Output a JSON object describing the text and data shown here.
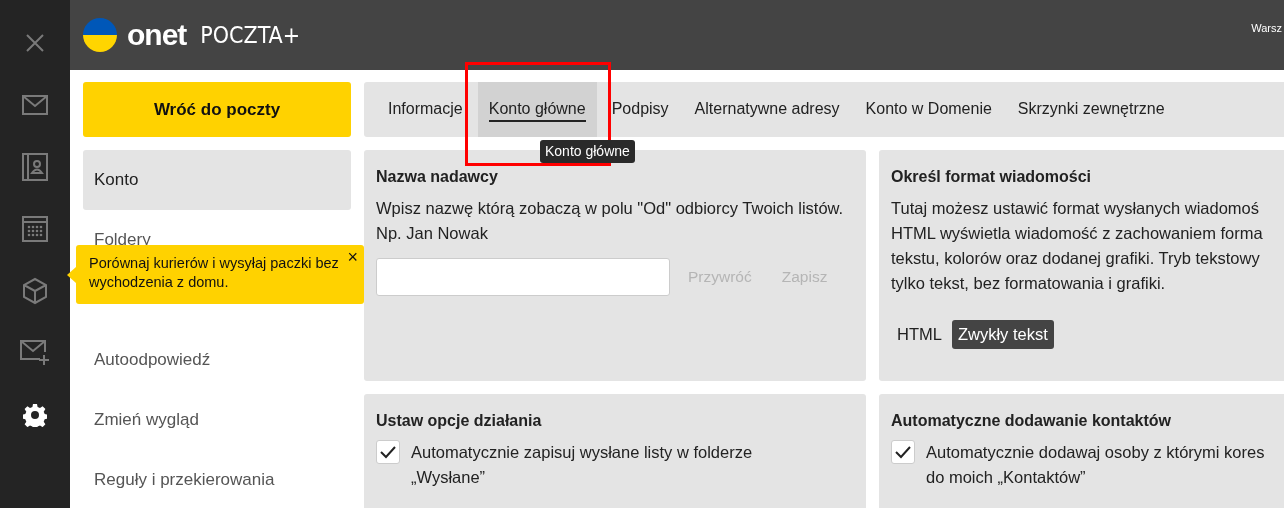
{
  "rail": {
    "items": [
      {
        "kind": "close",
        "selected": false
      },
      {
        "kind": "mail",
        "selected": false
      },
      {
        "kind": "contacts",
        "selected": false
      },
      {
        "kind": "calendar",
        "selected": false
      },
      {
        "kind": "parcel",
        "selected": false
      },
      {
        "kind": "compose",
        "selected": false
      },
      {
        "kind": "settings",
        "selected": true
      }
    ]
  },
  "header": {
    "brand": "onet",
    "product": "POCZTA+",
    "location": "Warsz"
  },
  "back_button": "Wróć do poczty",
  "menu": {
    "items": [
      {
        "label": "Konto",
        "selected": true
      },
      {
        "label": "Foldery",
        "selected": false
      }
    ],
    "more_items": [
      {
        "label": "Autoodpowiedź",
        "selected": false
      },
      {
        "label": "Zmień wygląd",
        "selected": false
      },
      {
        "label": "Reguły i przekierowania",
        "selected": false
      }
    ]
  },
  "promo": {
    "text": "Porównaj kurierów i wysyłaj paczki bez wychodzenia z domu.",
    "close": "×"
  },
  "tabs": [
    {
      "label": "Informacje",
      "selected": false
    },
    {
      "label": "Konto główne",
      "selected": true
    },
    {
      "label": "Podpisy",
      "selected": false
    },
    {
      "label": "Alternatywne adresy",
      "selected": false
    },
    {
      "label": "Konto w Domenie",
      "selected": false
    },
    {
      "label": "Skrzynki zewnętrzne",
      "selected": false
    }
  ],
  "tooltip": "Konto główne",
  "sender_card": {
    "title": "Nazwa nadawcy",
    "description": "Wpisz nazwę którą zobaczą w polu \"Od\" odbiorcy Twoich listów. Np. Jan Nowak",
    "buttons": [
      {
        "label": "Przywróć",
        "disabled": true
      },
      {
        "label": "Zapisz",
        "disabled": true
      }
    ]
  },
  "format_card": {
    "title": "Określ format wiadomości",
    "lines": [
      "Tutaj możesz ustawić format wysłanych wiadomoś",
      "HTML wyświetla wiadomość z zachowaniem forma",
      "tekstu, kolorów oraz dodanej grafiki. Tryb tekstowy",
      "tylko tekst, bez formatowania i grafiki."
    ],
    "options": [
      {
        "label": "HTML",
        "selected": false
      },
      {
        "label": "Zwykły tekst",
        "selected": true
      }
    ]
  },
  "options_card": {
    "title": "Ustaw opcje działania",
    "checkboxes": [
      {
        "lines": [
          "Automatycznie zapisuj wysłane listy w folderze",
          "„Wysłane”"
        ],
        "checked": true
      }
    ]
  },
  "contacts_card": {
    "title": "Automatyczne dodawanie kontaktów",
    "checkboxes": [
      {
        "lines": [
          "Automatycznie dodawaj osoby z którymi kores",
          "do moich „Kontaktów”"
        ],
        "checked": true
      }
    ]
  },
  "annotation": {
    "kind": "highlight-frame",
    "color": "#ff0000"
  }
}
